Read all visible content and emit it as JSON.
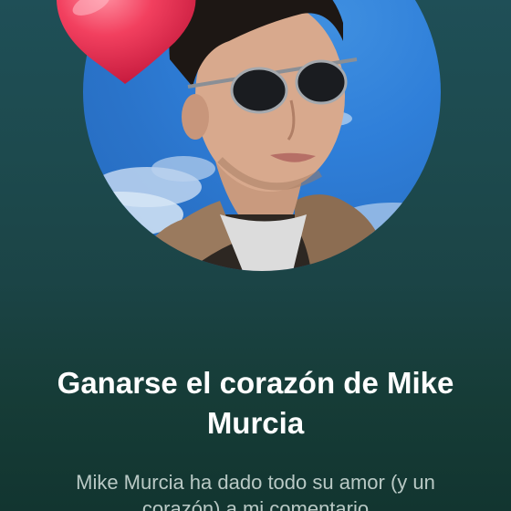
{
  "card": {
    "title": "Ganarse el corazón de Mike Murcia",
    "description": "Mike Murcia ha dado todo su amor (y un corazón) a mi comentario"
  },
  "icons": {
    "heart": "heart-icon"
  },
  "colors": {
    "background_top": "#1f4f57",
    "background_bottom": "#123530",
    "heart": "#f0385e",
    "title": "#ffffff",
    "description": "#b9c9c5"
  }
}
